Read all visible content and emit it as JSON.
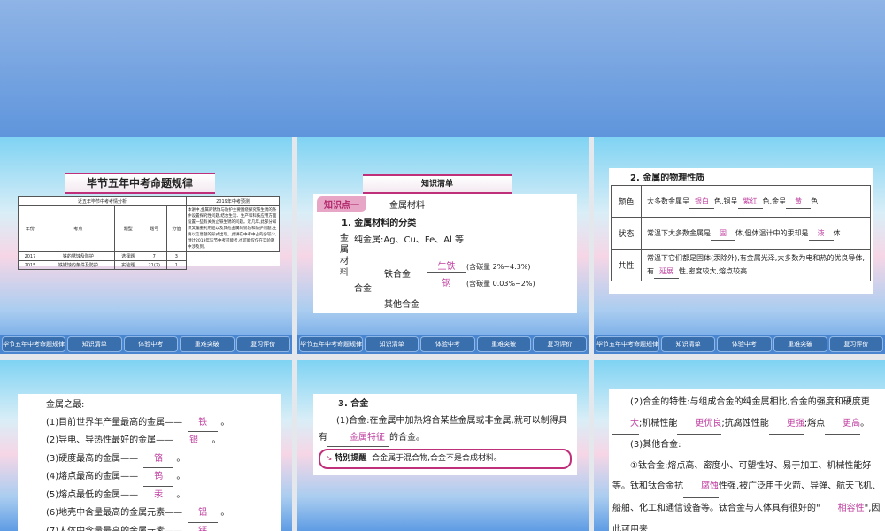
{
  "nav": [
    "毕节五年中考命题规律",
    "知识清单",
    "体验中考",
    "重难突破",
    "复习评价"
  ],
  "slide1": {
    "title": "毕节五年中考命题规律",
    "table_head_left": "近五年毕节中考考情分析",
    "table_head_right": "2019年中考预测",
    "columns": [
      "年份",
      "考点",
      "题型",
      "题号",
      "分值"
    ],
    "rows": [
      [
        "2017",
        "铁的锈蚀及防护",
        "选择题",
        "7",
        "3"
      ],
      [
        "2015",
        "铁锈蚀的条件及防护",
        "实验题",
        "21(2)",
        "1"
      ]
    ],
    "prediction": "本讲中,金属的锈蚀与防护主要围绕探究铁生锈的条件设置探究性问题,结合生活、生产和科技应用方面设置一些有关防止铁生锈的问题。近几年,此部分知识又偏重利用铝以及其他金属的锈蚀和防护问题,主要以信息题的形式出现。此讲在中考中占的分较少,预计2019年毕节中考可能考,也可能仅仅在实验题中涉及到。"
  },
  "slide2": {
    "title": "知识清单",
    "tag": "知识点一",
    "topic": "金属材料",
    "heading": "1. 金属材料的分类",
    "root": "金属材料",
    "pure": "纯金属:Ag、Cu、Fe、Al 等",
    "alloy": "合金",
    "iron_alloy": "铁合金",
    "ans1": "生铁",
    "note1": "(含碳量 2%~4.3%)",
    "ans2": "钢",
    "note2": "(含碳量 0.03%~2%)",
    "other": "其他合金"
  },
  "slide3": {
    "heading": "2. 金属的物理性质",
    "rows": [
      {
        "label": "颜色",
        "parts": [
          "大多数金属呈",
          {
            "a": "银白"
          },
          "色,铜呈",
          {
            "a": "紫红"
          },
          "色,金呈",
          {
            "a": "黄"
          },
          "色"
        ]
      },
      {
        "label": "状态",
        "parts": [
          "常温下大多数金属是",
          {
            "a": "固"
          },
          "体,但体温计中的汞却是",
          {
            "a": "液"
          },
          "体"
        ]
      },
      {
        "label": "共性",
        "parts": [
          "常温下它们都是固体(汞除外),有金属光泽,大多数为电和热的优良导体,有",
          {
            "a": "延展"
          },
          "性,密度较大,熔点较高"
        ]
      }
    ]
  },
  "slide4": {
    "heading": "金属之最:",
    "items": [
      [
        "(1)目前世界年产量最高的金属——",
        "铁"
      ],
      [
        "(2)导电、导热性最好的金属——",
        "银"
      ],
      [
        "(3)硬度最高的金属——",
        "铬"
      ],
      [
        "(4)熔点最高的金属——",
        "钨"
      ],
      [
        "(5)熔点最低的金属——",
        "汞"
      ],
      [
        "(6)地壳中含量最高的金属元素——",
        "铝"
      ],
      [
        "(7)人体中含量最高的金属元素——",
        "钙"
      ]
    ]
  },
  "slide5": {
    "heading": "3. 合金",
    "p1": "(1)合金:在金属中加热熔合某些金属或非金属,就可以制得具有",
    "ans": "金属特征",
    "p1end": "的合金。",
    "tip_label": "特别提醒",
    "tip": "合金属于混合物,合金不是合成材料。"
  },
  "slide6": {
    "parts": [
      "(2)合金的特性:与组成合金的纯金属相比,合金的强度和硬度更",
      {
        "a": "大"
      },
      ";机械性能",
      {
        "a": "更优良"
      },
      ";抗腐蚀性能",
      {
        "a": "更强"
      },
      ";熔点",
      {
        "a": "更高"
      },
      "。"
    ],
    "p2": "(3)其他合金:",
    "parts3": [
      "①钛合金:熔点高、密度小、可塑性好、易于加工、机械性能好等。钛和钛合金抗",
      {
        "a": "腐蚀"
      },
      "性强,被广泛用于火箭、导弹、航天飞机、船舶、化工和通信设备等。钛合金与人体具有很好的\"",
      {
        "a": "相容性"
      },
      "\",因此可用来"
    ]
  }
}
